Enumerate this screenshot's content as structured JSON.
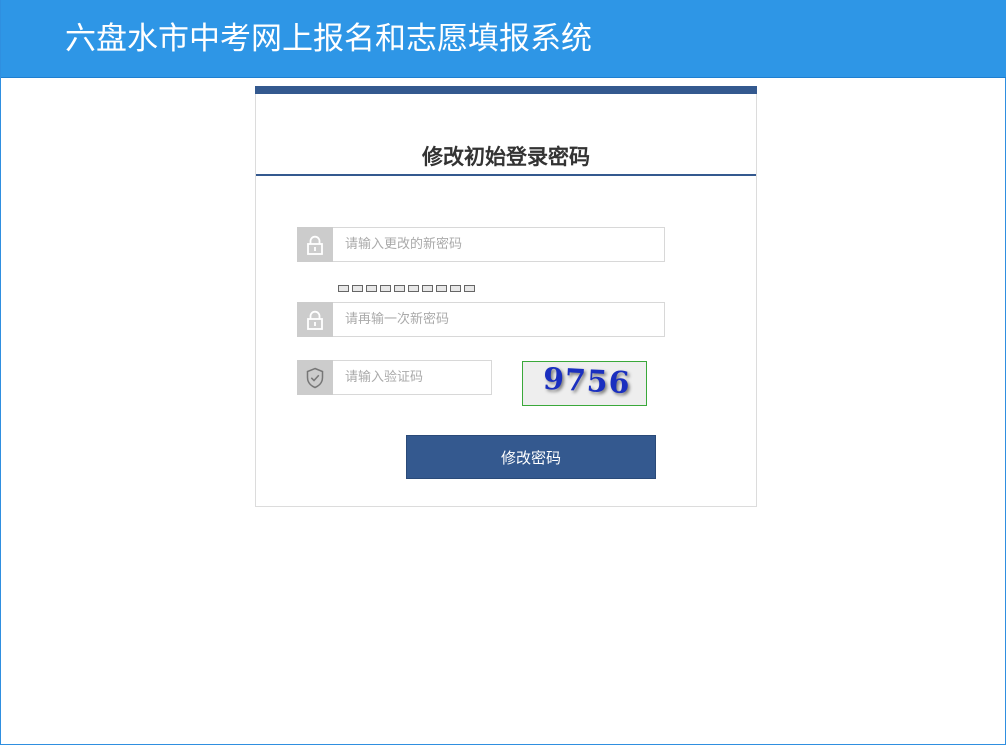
{
  "header": {
    "title": "六盘水市中考网上报名和志愿填报系统"
  },
  "form": {
    "title": "修改初始登录密码",
    "new_password": {
      "placeholder": "请输入更改的新密码",
      "value": "",
      "icon": "lock-icon"
    },
    "strength_meter": {
      "segments": 10,
      "filled": 0
    },
    "confirm_password": {
      "placeholder": "请再输一次新密码",
      "value": "",
      "icon": "lock-icon"
    },
    "captcha_input": {
      "placeholder": "请输入验证码",
      "value": "",
      "icon": "shield-check-icon"
    },
    "captcha_image_text": "9756",
    "submit_label": "修改密码"
  },
  "colors": {
    "header_bg": "#2e96e6",
    "accent": "#34598f",
    "icon_bg": "#cccccc",
    "captcha_border": "#3aa83a",
    "captcha_text": "#1a2fbf"
  }
}
